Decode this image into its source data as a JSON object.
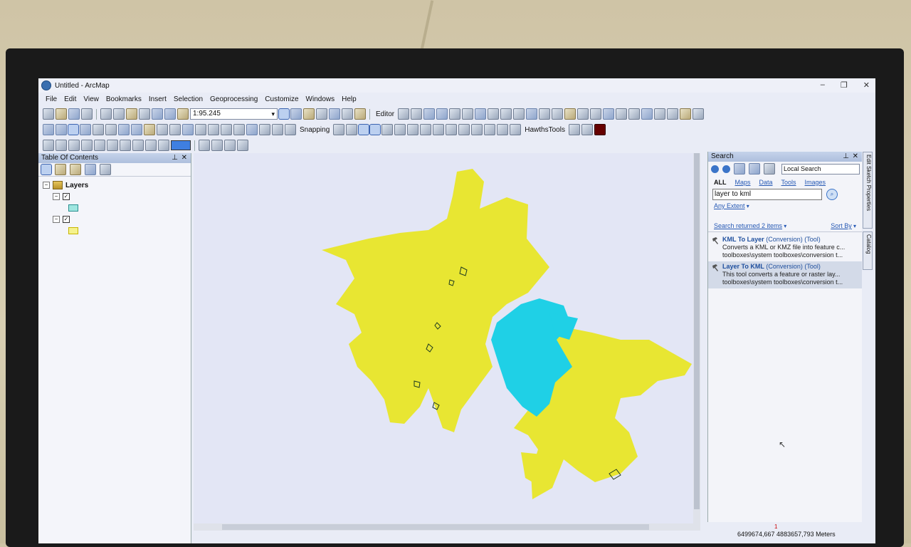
{
  "window": {
    "title": "Untitled - ArcMap",
    "controls": [
      "–",
      "❐",
      "✕"
    ]
  },
  "menu": [
    "File",
    "Edit",
    "View",
    "Bookmarks",
    "Insert",
    "Selection",
    "Geoprocessing",
    "Customize",
    "Windows",
    "Help"
  ],
  "toolbar": {
    "scale": "1:95.245",
    "editor_label": "Editor",
    "snapping_label": "Snapping",
    "hawths_label": "HawthsTools"
  },
  "toc": {
    "title": "Table Of Contents",
    "root_label": "Layers",
    "layers": [
      {
        "checked": true,
        "symbol_color": "#9fe6e0",
        "symbol_border": "#2a9090"
      },
      {
        "checked": true,
        "symbol_color": "#f5f28c",
        "symbol_border": "#c8b600"
      }
    ]
  },
  "map": {
    "colors": {
      "yellow_layer": "#e8e632",
      "cyan_layer": "#1fd0e6",
      "outline": "#1e3a20"
    }
  },
  "search": {
    "title": "Search",
    "location": "Local Search",
    "tabs": [
      "ALL",
      "Maps",
      "Data",
      "Tools",
      "Images"
    ],
    "query": "layer to kml",
    "extent_label": "Any Extent",
    "returned_label": "Search returned 2 items",
    "sort_label": "Sort By",
    "results": [
      {
        "title": "KML To Layer",
        "meta": "(Conversion) (Tool)",
        "desc": "Converts a KML or KMZ file into feature c...",
        "path": "toolboxes\\system toolboxes\\conversion t..."
      },
      {
        "title": "Layer To KML",
        "meta": "(Conversion) (Tool)",
        "desc": "This tool converts a feature or raster lay...",
        "path": "toolboxes\\system toolboxes\\conversion t..."
      }
    ]
  },
  "side_tabs": [
    "Edit Sketch Properties",
    "Catalog"
  ],
  "status": {
    "marker": "1",
    "coordinates": "6499674,667  4883657,793 Meters"
  }
}
